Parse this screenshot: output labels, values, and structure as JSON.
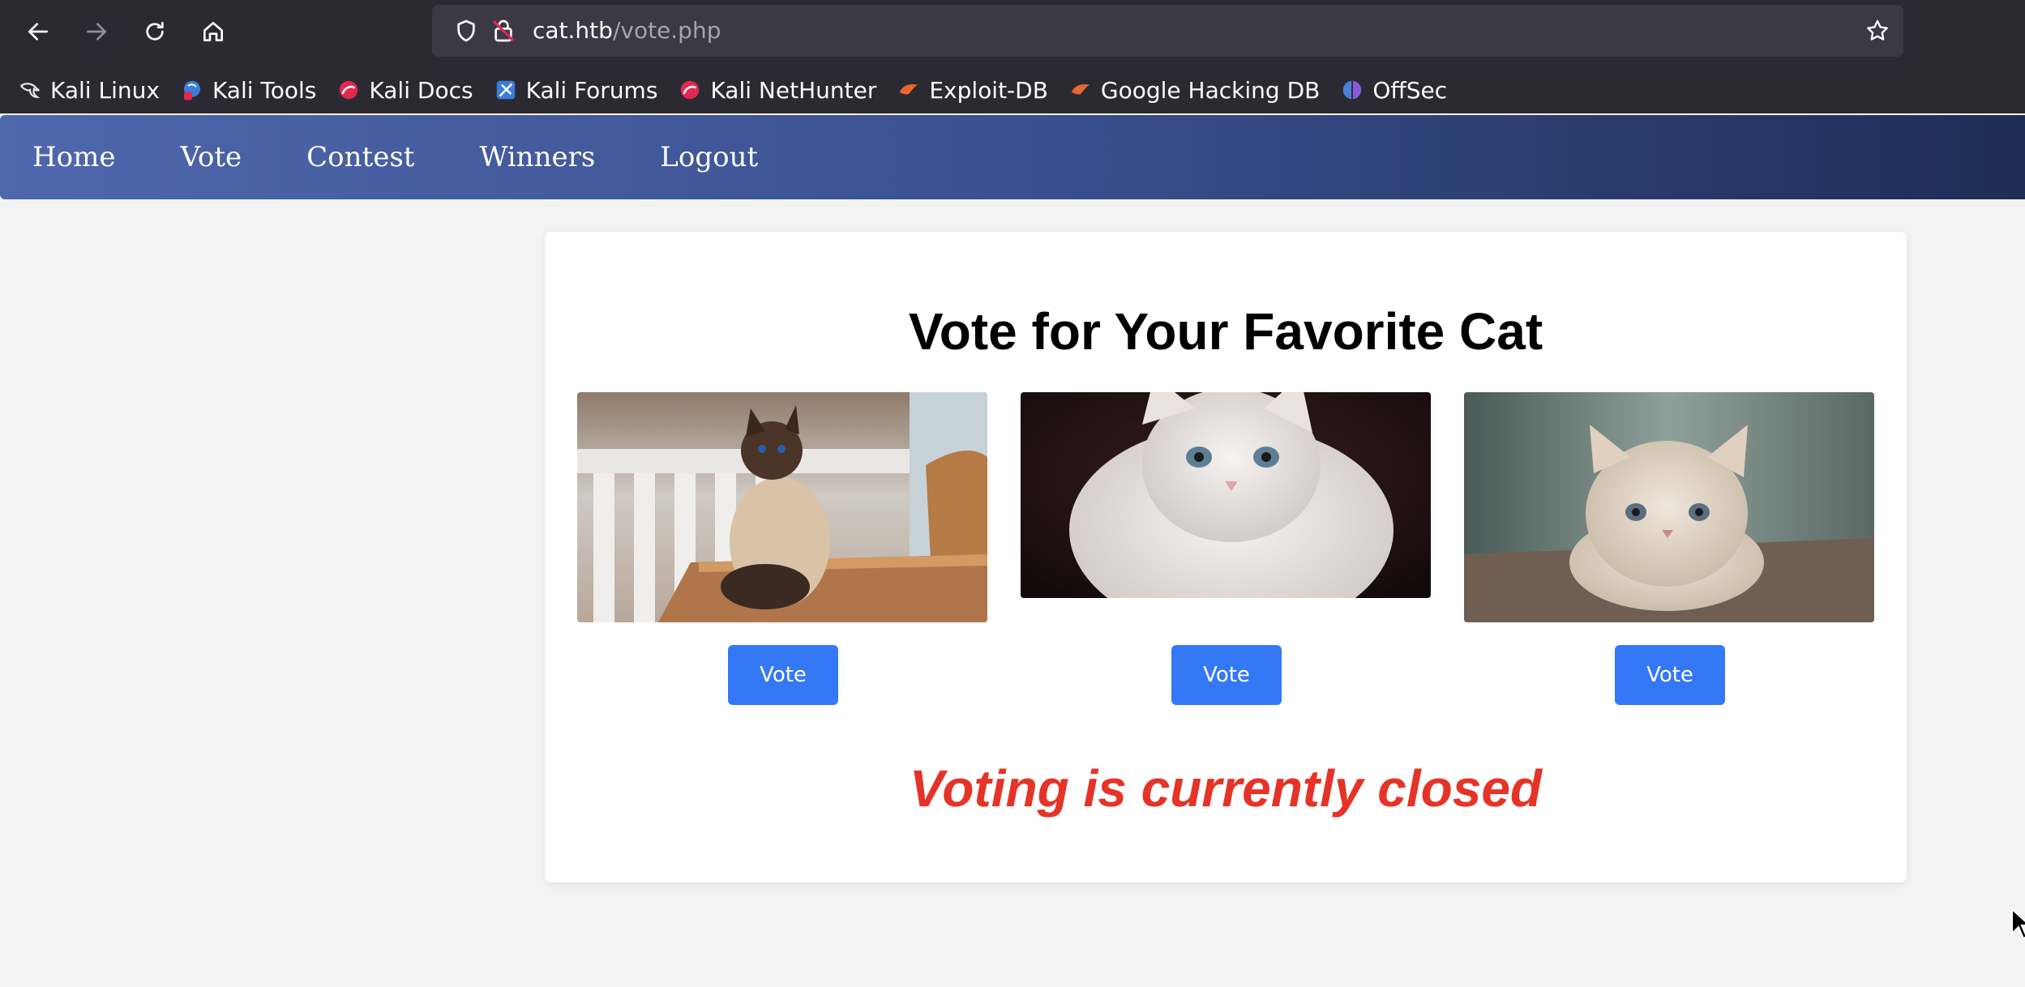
{
  "browser": {
    "url_host": "cat.htb",
    "url_path": "/vote.php",
    "bookmarks": [
      {
        "label": "Kali Linux",
        "icon": "kali-dragon-icon"
      },
      {
        "label": "Kali Tools",
        "icon": "kali-tools-icon"
      },
      {
        "label": "Kali Docs",
        "icon": "kali-docs-icon"
      },
      {
        "label": "Kali Forums",
        "icon": "kali-forums-icon"
      },
      {
        "label": "Kali NetHunter",
        "icon": "kali-nethunter-icon"
      },
      {
        "label": "Exploit-DB",
        "icon": "exploit-db-icon"
      },
      {
        "label": "Google Hacking DB",
        "icon": "ghdb-icon"
      },
      {
        "label": "OffSec",
        "icon": "offsec-icon"
      }
    ]
  },
  "site_nav": {
    "items": [
      "Home",
      "Vote",
      "Contest",
      "Winners",
      "Logout"
    ]
  },
  "main": {
    "title": "Vote for Your Favorite Cat",
    "cats": [
      {
        "image": "siamese-cat-photo",
        "button_label": "Vote"
      },
      {
        "image": "white-kitten-photo",
        "button_label": "Vote"
      },
      {
        "image": "fluffy-kitten-photo",
        "button_label": "Vote"
      }
    ],
    "status_message": "Voting is currently closed"
  },
  "colors": {
    "vote_button": "#3578f6",
    "closed_message": "#e53327",
    "nav_gradient_start": "#4f67ad",
    "nav_gradient_end": "#1f2d55"
  }
}
